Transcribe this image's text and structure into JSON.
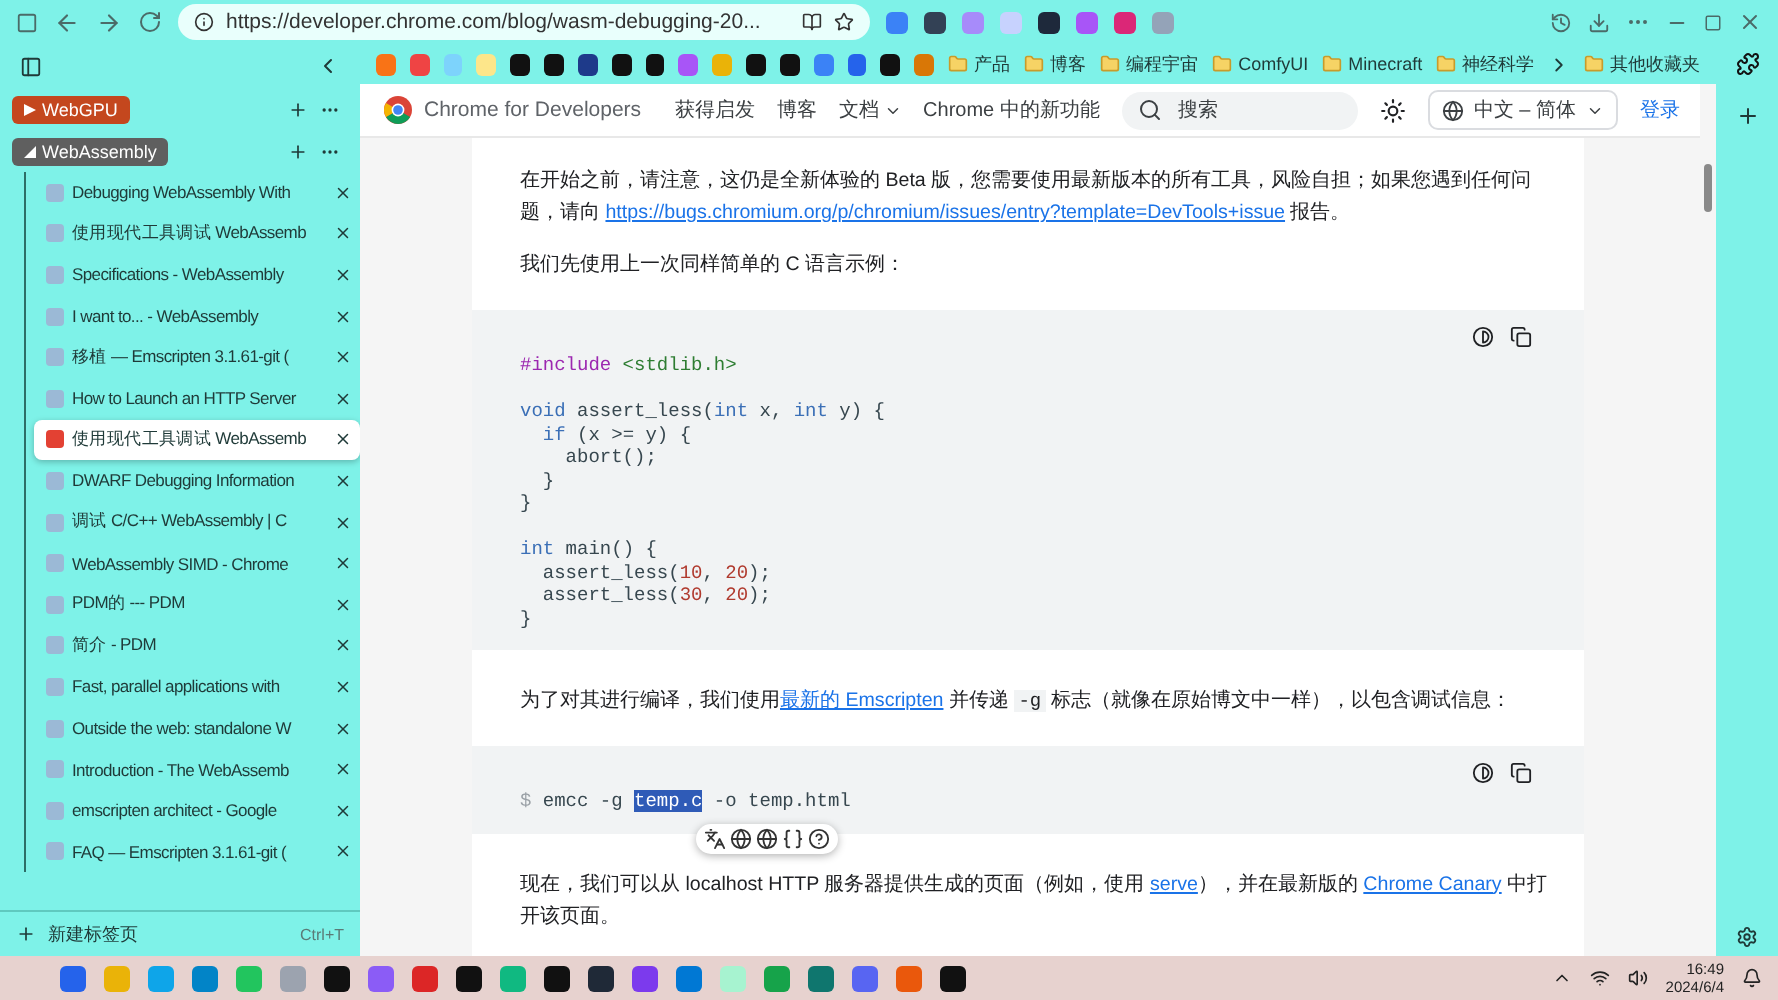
{
  "browser": {
    "url": "https://developer.chrome.com/blog/wasm-debugging-20..."
  },
  "bookmarks": [
    {
      "label": "产品"
    },
    {
      "label": "博客"
    },
    {
      "label": "编程宇宙"
    },
    {
      "label": "ComfyUI"
    },
    {
      "label": "Minecraft"
    },
    {
      "label": "神经科学"
    }
  ],
  "other_bookmarks": "其他收藏夹",
  "sidebar": {
    "groups": [
      {
        "label": "WebGPU",
        "color": "#c4471e",
        "expanded": false
      },
      {
        "label": "WebAssembly",
        "color": "#5f5f5f",
        "expanded": true,
        "tabs": [
          {
            "title": "Debugging WebAssembly With",
            "selected": false
          },
          {
            "title": "使用现代工具调试 WebAssemb",
            "selected": false
          },
          {
            "title": "Specifications - WebAssembly",
            "selected": false
          },
          {
            "title": "I want to... - WebAssembly",
            "selected": false
          },
          {
            "title": "移植 — Emscripten 3.1.61-git (",
            "selected": false
          },
          {
            "title": "How to Launch an HTTP Server",
            "selected": false
          },
          {
            "title": "使用现代工具调试 WebAssemb",
            "selected": true
          },
          {
            "title": "DWARF Debugging Information",
            "selected": false
          },
          {
            "title": "调试 C/C++ WebAssembly | C",
            "selected": false
          },
          {
            "title": "WebAssembly SIMD - Chrome",
            "selected": false
          },
          {
            "title": "PDM的 --- PDM",
            "selected": false
          },
          {
            "title": "简介 - PDM",
            "selected": false
          },
          {
            "title": "Fast, parallel applications with",
            "selected": false
          },
          {
            "title": "Outside the web: standalone W",
            "selected": false
          },
          {
            "title": "Introduction - The WebAssemb",
            "selected": false
          },
          {
            "title": "emscripten architect - Google",
            "selected": false
          },
          {
            "title": "FAQ — Emscripten 3.1.61-git (",
            "selected": false
          }
        ]
      }
    ],
    "new_tab": {
      "label": "新建标签页",
      "shortcut": "Ctrl+T"
    }
  },
  "site": {
    "brand": "Chrome for Developers",
    "nav": [
      {
        "label": "获得启发",
        "dropdown": false
      },
      {
        "label": "博客",
        "dropdown": false
      },
      {
        "label": "文档",
        "dropdown": true
      },
      {
        "label": "Chrome 中的新功能",
        "dropdown": false
      }
    ],
    "search": {
      "placeholder": "搜索"
    },
    "language": "中文 – 简体",
    "login": "登录"
  },
  "article": [
    {
      "kind": "paragraph",
      "segments": [
        {
          "kind": "text",
          "text": "在开始之前，请注意，这仍是全新体验的 Beta 版，您需要使用最新版本的所有工具，风险自担；如果您遇到任何问题，请向 "
        },
        {
          "kind": "link",
          "text": "https://bugs.chromium.org/p/chromium/issues/entry?template=DevTools+issue"
        },
        {
          "kind": "text",
          "text": " 报告。"
        }
      ]
    },
    {
      "kind": "paragraph",
      "segments": [
        {
          "kind": "text",
          "text": "我们先使用上一次同样简单的 C 语言示例："
        }
      ]
    },
    {
      "kind": "code",
      "lines": [
        {
          "kind": "tokens",
          "tokens": [
            {
              "kind": "pre",
              "text": "#include"
            },
            {
              "kind": "str",
              "text": " <stdlib.h>"
            }
          ]
        },
        {
          "kind": "blank"
        },
        {
          "kind": "tokens",
          "tokens": [
            {
              "kind": "kw",
              "text": "void"
            },
            {
              "kind": "plain",
              "text": " assert_less("
            },
            {
              "kind": "kw",
              "text": "int"
            },
            {
              "kind": "plain",
              "text": " x, "
            },
            {
              "kind": "kw",
              "text": "int"
            },
            {
              "kind": "plain",
              "text": " y) {"
            }
          ]
        },
        {
          "kind": "tokens",
          "tokens": [
            {
              "kind": "kw",
              "text": "  if"
            },
            {
              "kind": "plain",
              "text": " (x >= y) {"
            }
          ]
        },
        {
          "kind": "tokens",
          "tokens": [
            {
              "kind": "plain",
              "text": "    abort();"
            }
          ]
        },
        {
          "kind": "tokens",
          "tokens": [
            {
              "kind": "plain",
              "text": "  }"
            }
          ]
        },
        {
          "kind": "tokens",
          "tokens": [
            {
              "kind": "plain",
              "text": "}"
            }
          ]
        },
        {
          "kind": "blank"
        },
        {
          "kind": "tokens",
          "tokens": [
            {
              "kind": "kw",
              "text": "int"
            },
            {
              "kind": "plain",
              "text": " main() {"
            }
          ]
        },
        {
          "kind": "tokens",
          "tokens": [
            {
              "kind": "plain",
              "text": "  assert_less("
            },
            {
              "kind": "num",
              "text": "10"
            },
            {
              "kind": "plain",
              "text": ", "
            },
            {
              "kind": "num",
              "text": "20"
            },
            {
              "kind": "plain",
              "text": ");"
            }
          ]
        },
        {
          "kind": "tokens",
          "tokens": [
            {
              "kind": "plain",
              "text": "  assert_less("
            },
            {
              "kind": "num",
              "text": "30"
            },
            {
              "kind": "plain",
              "text": ", "
            },
            {
              "kind": "num",
              "text": "20"
            },
            {
              "kind": "plain",
              "text": ");"
            }
          ]
        },
        {
          "kind": "tokens",
          "tokens": [
            {
              "kind": "plain",
              "text": "}"
            }
          ]
        }
      ]
    },
    {
      "kind": "paragraph",
      "segments": [
        {
          "kind": "text",
          "text": "为了对其进行编译，我们使用"
        },
        {
          "kind": "link",
          "text": "最新的 Emscripten"
        },
        {
          "kind": "text",
          "text": " 并传递 "
        },
        {
          "kind": "code",
          "text": "-g"
        },
        {
          "kind": "text",
          "text": " 标志（就像在原始博文中一样），以包含调试信息："
        }
      ]
    },
    {
      "kind": "code",
      "popup": true,
      "lines": [
        {
          "kind": "tokens",
          "tokens": [
            {
              "kind": "prompt",
              "text": "$"
            },
            {
              "kind": "plain",
              "text": " emcc -g "
            },
            {
              "kind": "selected",
              "text": "temp.c"
            },
            {
              "kind": "plain",
              "text": " -o temp.html"
            }
          ]
        }
      ]
    },
    {
      "kind": "paragraph",
      "segments": [
        {
          "kind": "text",
          "text": "现在，我们可以从 localhost HTTP 服务器提供生成的页面（例如，使用 "
        },
        {
          "kind": "link",
          "text": "serve"
        },
        {
          "kind": "text",
          "text": "），并在最新版的 "
        },
        {
          "kind": "link",
          "text": "Chrome Canary"
        },
        {
          "kind": "text",
          "text": " 中打开该页面。"
        }
      ]
    }
  ],
  "taskbar": {
    "time": "16:49",
    "date": "2024/6/4"
  }
}
